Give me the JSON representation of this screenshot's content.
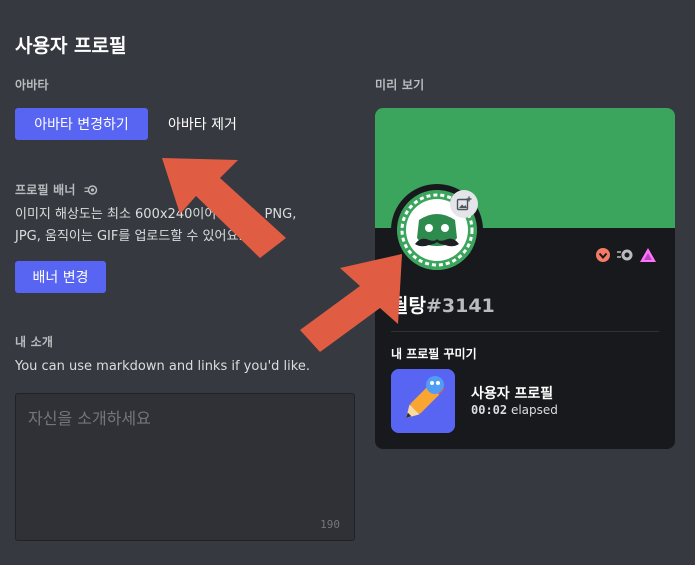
{
  "page": {
    "title": "사용자 프로필"
  },
  "avatar_section": {
    "label": "아바타",
    "change_button": "아바타 변경하기",
    "remove_button": "아바타 제거"
  },
  "banner_section": {
    "label": "프로필 배너",
    "description_line1": "이미지 해상도는 최소 600x240이어야 해요. PNG,",
    "description_line2": "JPG, 움직이는 GIF를 업로드할 수 있어요.",
    "change_button": "배너 변경"
  },
  "bio_section": {
    "label": "내 소개",
    "hint": "You can use markdown and links if you'd like.",
    "placeholder": "자신을 소개하세요",
    "counter": "190"
  },
  "preview": {
    "label": "미리 보기",
    "username": "뒬탕",
    "discriminator": "#3141",
    "customize_label": "내 프로필 꾸미기",
    "activity_title": "사용자 프로필",
    "activity_time": "00:02",
    "activity_suffix": "elapsed"
  },
  "colors": {
    "background": "#36393f",
    "accent": "#5865f2",
    "banner": "#3ba55d",
    "card": "#18191c",
    "arrow": "#e05d44"
  },
  "icons": [
    "nitro-icon",
    "image-add-icon",
    "hypesquad-icon",
    "nitro-badge-icon",
    "boost-badge-icon",
    "clyde-mustache-icon",
    "pencil-icon"
  ]
}
